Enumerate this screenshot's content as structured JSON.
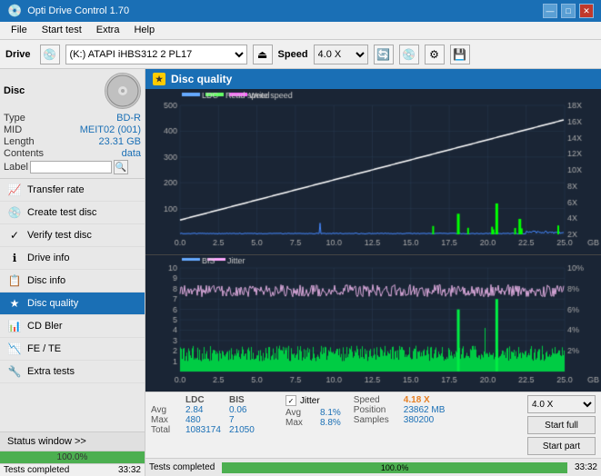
{
  "titlebar": {
    "title": "Opti Drive Control 1.70",
    "minimize": "—",
    "maximize": "□",
    "close": "✕"
  },
  "menubar": {
    "items": [
      "File",
      "Start test",
      "Extra",
      "Help"
    ]
  },
  "toolbar": {
    "drive_label": "Drive",
    "drive_value": "(K:)  ATAPI iHBS312  2 PL17",
    "speed_label": "Speed",
    "speed_value": "4.0 X"
  },
  "disc": {
    "title": "Disc",
    "type_label": "Type",
    "type_value": "BD-R",
    "mid_label": "MID",
    "mid_value": "MEIT02 (001)",
    "length_label": "Length",
    "length_value": "23.31 GB",
    "contents_label": "Contents",
    "contents_value": "data",
    "label_label": "Label"
  },
  "nav_items": [
    {
      "id": "transfer-rate",
      "label": "Transfer rate",
      "icon": "📈"
    },
    {
      "id": "create-test-disc",
      "label": "Create test disc",
      "icon": "💿"
    },
    {
      "id": "verify-test-disc",
      "label": "Verify test disc",
      "icon": "✓"
    },
    {
      "id": "drive-info",
      "label": "Drive info",
      "icon": "ℹ"
    },
    {
      "id": "disc-info",
      "label": "Disc info",
      "icon": "📋"
    },
    {
      "id": "disc-quality",
      "label": "Disc quality",
      "icon": "★",
      "active": true
    },
    {
      "id": "cd-bler",
      "label": "CD Bler",
      "icon": "📊"
    },
    {
      "id": "fe-te",
      "label": "FE / TE",
      "icon": "📉"
    },
    {
      "id": "extra-tests",
      "label": "Extra tests",
      "icon": "🔧"
    }
  ],
  "status_window": "Status window >>",
  "dq_title": "Disc quality",
  "legend": {
    "ldc": "LDC",
    "read_speed": "Read speed",
    "write_speed": "Write speed"
  },
  "legend2": {
    "bis": "BIS",
    "jitter": "Jitter"
  },
  "chart_top": {
    "y_max": 500,
    "y_labels": [
      "500",
      "400",
      "300",
      "200",
      "100"
    ],
    "x_labels": [
      "0.0",
      "2.5",
      "5.0",
      "7.5",
      "10.0",
      "12.5",
      "15.0",
      "17.5",
      "20.0",
      "22.5",
      "25.0"
    ],
    "right_labels": [
      "18X",
      "16X",
      "14X",
      "12X",
      "10X",
      "8X",
      "6X",
      "4X",
      "2X"
    ],
    "unit": "GB"
  },
  "chart_bottom": {
    "y_max": 10,
    "y_labels": [
      "10",
      "9",
      "8",
      "7",
      "6",
      "5",
      "4",
      "3",
      "2",
      "1"
    ],
    "x_labels": [
      "0.0",
      "2.5",
      "5.0",
      "7.5",
      "10.0",
      "12.5",
      "15.0",
      "17.5",
      "20.0",
      "22.5",
      "25.0"
    ],
    "right_labels": [
      "10%",
      "8%",
      "6%",
      "4%",
      "2%"
    ],
    "unit": "GB"
  },
  "stats": {
    "avg_label": "Avg",
    "max_label": "Max",
    "total_label": "Total",
    "ldc_avg": "2.84",
    "ldc_max": "480",
    "ldc_total": "1083174",
    "bis_avg": "0.06",
    "bis_max": "7",
    "bis_total": "21050",
    "jitter_checked": true,
    "jitter_avg": "8.1%",
    "jitter_max": "8.8%",
    "speed_label": "Speed",
    "speed_value": "4.18 X",
    "position_label": "Position",
    "position_value": "23862 MB",
    "samples_label": "Samples",
    "samples_value": "380200",
    "speed_select": "4.0 X"
  },
  "buttons": {
    "start_full": "Start full",
    "start_part": "Start part"
  },
  "bottom": {
    "status_text": "Tests completed",
    "progress": "100.0%",
    "time": "33:32"
  }
}
